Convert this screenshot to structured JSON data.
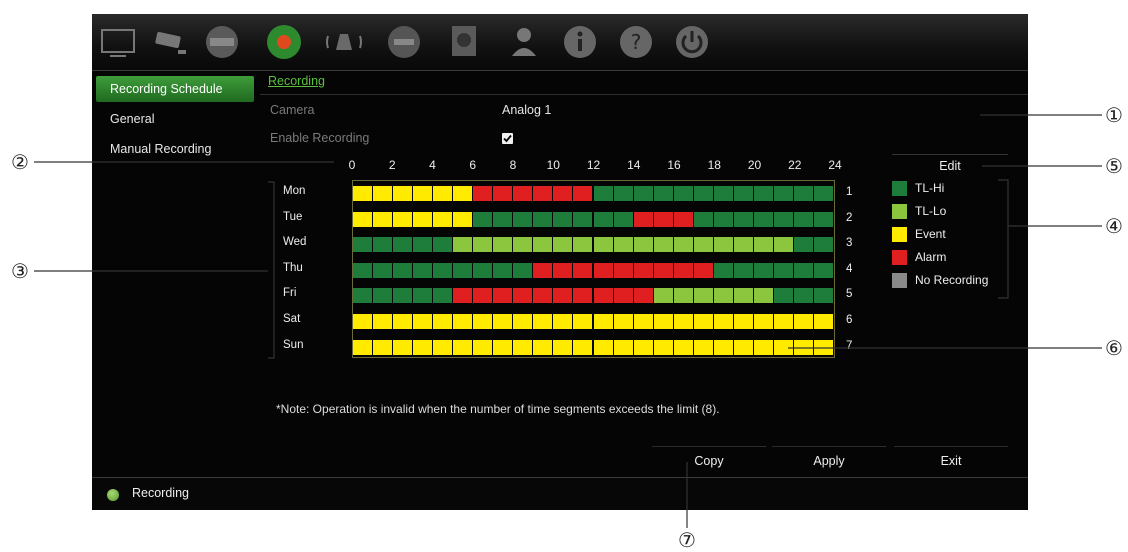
{
  "topbar": {
    "icons": [
      "monitor-icon",
      "cctv-camera-icon",
      "hdd-icon",
      "record-icon",
      "alarm-icon",
      "network-icon",
      "storage-icon",
      "user-icon",
      "info-icon",
      "help-icon",
      "power-icon"
    ],
    "active_icon": "record-icon"
  },
  "menu": {
    "items": [
      {
        "label": "Recording Schedule",
        "active": true
      },
      {
        "label": "General",
        "active": false
      },
      {
        "label": "Manual Recording",
        "active": false
      }
    ]
  },
  "tab": {
    "label": "Recording"
  },
  "camera": {
    "label": "Camera",
    "value": "Analog 1"
  },
  "enable_recording": {
    "label": "Enable Recording",
    "checked": true
  },
  "schedule": {
    "hour_labels": [
      "0",
      "2",
      "4",
      "6",
      "8",
      "10",
      "12",
      "14",
      "16",
      "18",
      "20",
      "22",
      "24"
    ],
    "days": [
      {
        "name": "Mon",
        "num": "1",
        "segments": [
          [
            "Event",
            0,
            6
          ],
          [
            "Alarm",
            6,
            12
          ],
          [
            "TL-Hi",
            12,
            24
          ]
        ]
      },
      {
        "name": "Tue",
        "num": "2",
        "segments": [
          [
            "Event",
            0,
            6
          ],
          [
            "TL-Hi",
            6,
            14
          ],
          [
            "Alarm",
            14,
            17
          ],
          [
            "TL-Hi",
            17,
            24
          ]
        ]
      },
      {
        "name": "Wed",
        "num": "3",
        "segments": [
          [
            "TL-Hi",
            0,
            5
          ],
          [
            "TL-Lo",
            5,
            22
          ],
          [
            "TL-Hi",
            22,
            24
          ]
        ]
      },
      {
        "name": "Thu",
        "num": "4",
        "segments": [
          [
            "TL-Hi",
            0,
            9
          ],
          [
            "Alarm",
            9,
            18
          ],
          [
            "TL-Hi",
            18,
            24
          ]
        ]
      },
      {
        "name": "Fri",
        "num": "5",
        "segments": [
          [
            "TL-Hi",
            0,
            5
          ],
          [
            "Alarm",
            5,
            15
          ],
          [
            "TL-Lo",
            15,
            21
          ],
          [
            "TL-Hi",
            21,
            24
          ]
        ]
      },
      {
        "name": "Sat",
        "num": "6",
        "segments": [
          [
            "Event",
            0,
            24
          ]
        ]
      },
      {
        "name": "Sun",
        "num": "7",
        "segments": [
          [
            "Event",
            0,
            24
          ]
        ]
      }
    ]
  },
  "edit": {
    "label": "Edit"
  },
  "legend": [
    {
      "label": "TL-Hi",
      "color": "#1e7d3a"
    },
    {
      "label": "TL-Lo",
      "color": "#8cc63f"
    },
    {
      "label": "Event",
      "color": "#ffea00"
    },
    {
      "label": "Alarm",
      "color": "#e02020"
    },
    {
      "label": "No Recording",
      "color": "#8a8a8a"
    }
  ],
  "note": "*Note: Operation is invalid when the number of time segments exceeds the limit (8).",
  "buttons": {
    "copy": "Copy",
    "apply": "Apply",
    "exit": "Exit"
  },
  "status": {
    "text": "Recording"
  },
  "callouts": [
    "①",
    "②",
    "③",
    "④",
    "⑤",
    "⑥",
    "⑦"
  ]
}
